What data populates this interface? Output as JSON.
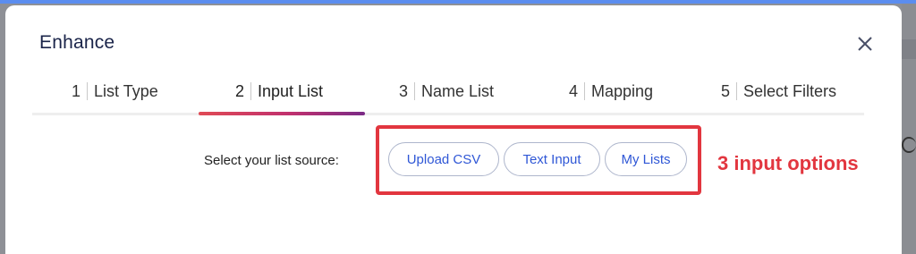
{
  "modal": {
    "title": "Enhance",
    "close_icon": "close-icon"
  },
  "steps": [
    {
      "num": "1",
      "label": "List Type"
    },
    {
      "num": "2",
      "label": "Input List",
      "active": true
    },
    {
      "num": "3",
      "label": "Name List"
    },
    {
      "num": "4",
      "label": "Mapping"
    },
    {
      "num": "5",
      "label": "Select Filters"
    }
  ],
  "source": {
    "label": "Select your list source:",
    "options": [
      "Upload CSV",
      "Text Input",
      "My Lists"
    ]
  },
  "annotation": {
    "text": "3 input options",
    "color": "#e2363f"
  },
  "colors": {
    "title": "#1a2449",
    "chip_text": "#2f57d6",
    "highlight": "#e2363f"
  }
}
